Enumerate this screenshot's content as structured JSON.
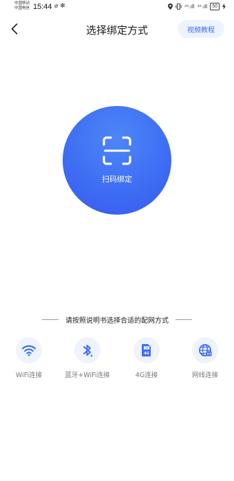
{
  "status_bar": {
    "carrier_1": "中国移动",
    "carrier_2": "中国电信",
    "time": "15:44",
    "left_icons": "⌀ ✻",
    "signal_1": "⁴⁶.ıll",
    "signal_2": "⁴⁶.ıll",
    "battery": "50"
  },
  "header": {
    "title": "选择绑定方式",
    "tutorial_label": "视频教程"
  },
  "scan": {
    "label": "扫码绑定"
  },
  "hint": {
    "text": "请按照说明书选择合适的配网方式"
  },
  "methods": [
    {
      "icon": "wifi-icon",
      "label": "WiFi连接"
    },
    {
      "icon": "bluetooth-icon",
      "label": "蓝牙+WiFi连接"
    },
    {
      "icon": "sim-card-4g-icon",
      "label": "4G连接"
    },
    {
      "icon": "ethernet-globe-icon",
      "label": "网线连接"
    }
  ],
  "colors": {
    "accent": "#3e6ef4",
    "icon_circle_bg": "#eef3fd",
    "tutorial_bg": "#eef4ff"
  }
}
